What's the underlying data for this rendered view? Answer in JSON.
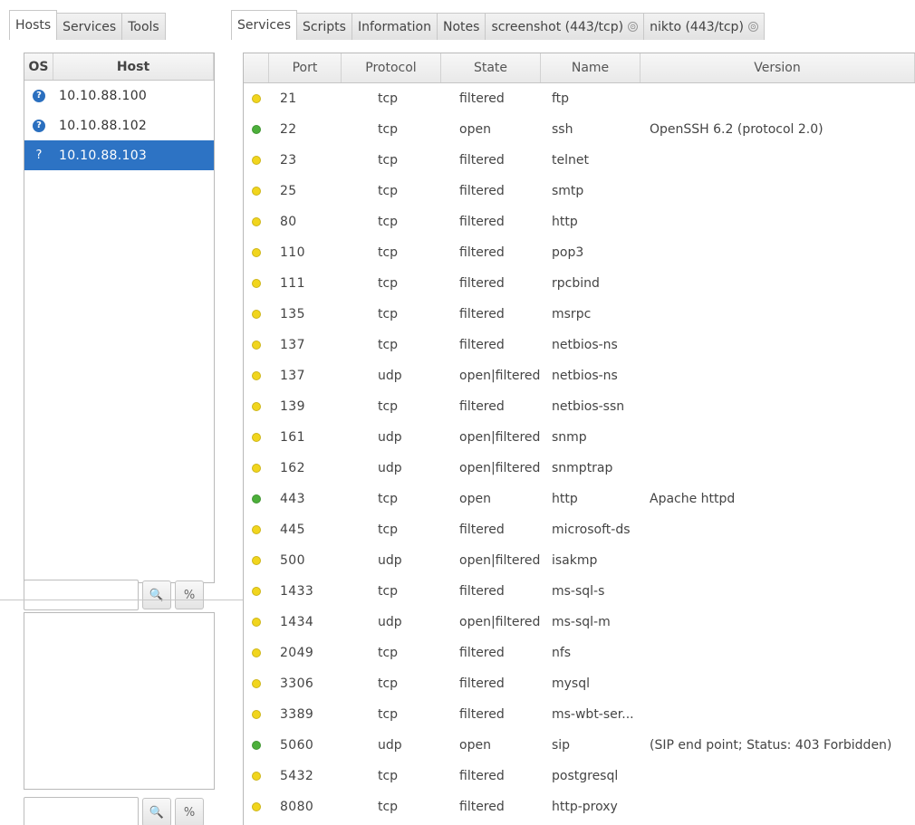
{
  "left_tabs": [
    "Hosts",
    "Services",
    "Tools"
  ],
  "right_tabs": [
    {
      "label": "Services"
    },
    {
      "label": "Scripts"
    },
    {
      "label": "Information"
    },
    {
      "label": "Notes"
    },
    {
      "label": "screenshot (443/tcp)"
    },
    {
      "label": "nikto (443/tcp)"
    }
  ],
  "tab_close_glyph": "⊙",
  "hosts_header": {
    "os": "OS",
    "host": "Host"
  },
  "hosts": [
    {
      "os_icon": "question-icon",
      "os": "?",
      "ip": "10.10.88.100"
    },
    {
      "os_icon": "question-icon",
      "os": "?",
      "ip": "10.10.88.102"
    },
    {
      "os_icon": "question-plain-icon",
      "os": "?",
      "ip": "10.10.88.103"
    }
  ],
  "filter": {
    "search_glyph": "🔍",
    "toggle_glyph": "%"
  },
  "services_header": {
    "port": "Port",
    "protocol": "Protocol",
    "state": "State",
    "name": "Name",
    "version": "Version"
  },
  "colors": {
    "open": "#4caf3a",
    "filtered": "#f1d51d",
    "selection": "#2d73c4"
  },
  "services": [
    {
      "port": "21",
      "protocol": "tcp",
      "state": "filtered",
      "name": "ftp",
      "version": ""
    },
    {
      "port": "22",
      "protocol": "tcp",
      "state": "open",
      "name": "ssh",
      "version": "OpenSSH 6.2 (protocol 2.0)"
    },
    {
      "port": "23",
      "protocol": "tcp",
      "state": "filtered",
      "name": "telnet",
      "version": ""
    },
    {
      "port": "25",
      "protocol": "tcp",
      "state": "filtered",
      "name": "smtp",
      "version": ""
    },
    {
      "port": "80",
      "protocol": "tcp",
      "state": "filtered",
      "name": "http",
      "version": ""
    },
    {
      "port": "110",
      "protocol": "tcp",
      "state": "filtered",
      "name": "pop3",
      "version": ""
    },
    {
      "port": "111",
      "protocol": "tcp",
      "state": "filtered",
      "name": "rpcbind",
      "version": ""
    },
    {
      "port": "135",
      "protocol": "tcp",
      "state": "filtered",
      "name": "msrpc",
      "version": ""
    },
    {
      "port": "137",
      "protocol": "tcp",
      "state": "filtered",
      "name": "netbios-ns",
      "version": ""
    },
    {
      "port": "137",
      "protocol": "udp",
      "state": "open|filtered",
      "name": "netbios-ns",
      "version": ""
    },
    {
      "port": "139",
      "protocol": "tcp",
      "state": "filtered",
      "name": "netbios-ssn",
      "version": ""
    },
    {
      "port": "161",
      "protocol": "udp",
      "state": "open|filtered",
      "name": "snmp",
      "version": ""
    },
    {
      "port": "162",
      "protocol": "udp",
      "state": "open|filtered",
      "name": "snmptrap",
      "version": ""
    },
    {
      "port": "443",
      "protocol": "tcp",
      "state": "open",
      "name": "http",
      "version": "Apache httpd"
    },
    {
      "port": "445",
      "protocol": "tcp",
      "state": "filtered",
      "name": "microsoft-ds",
      "version": ""
    },
    {
      "port": "500",
      "protocol": "udp",
      "state": "open|filtered",
      "name": "isakmp",
      "version": ""
    },
    {
      "port": "1433",
      "protocol": "tcp",
      "state": "filtered",
      "name": "ms-sql-s",
      "version": ""
    },
    {
      "port": "1434",
      "protocol": "udp",
      "state": "open|filtered",
      "name": "ms-sql-m",
      "version": ""
    },
    {
      "port": "2049",
      "protocol": "tcp",
      "state": "filtered",
      "name": "nfs",
      "version": ""
    },
    {
      "port": "3306",
      "protocol": "tcp",
      "state": "filtered",
      "name": "mysql",
      "version": ""
    },
    {
      "port": "3389",
      "protocol": "tcp",
      "state": "filtered",
      "name": "ms-wbt-ser...",
      "version": ""
    },
    {
      "port": "5060",
      "protocol": "udp",
      "state": "open",
      "name": "sip",
      "version": "(SIP end point; Status: 403 Forbidden)"
    },
    {
      "port": "5432",
      "protocol": "tcp",
      "state": "filtered",
      "name": "postgresql",
      "version": ""
    },
    {
      "port": "8080",
      "protocol": "tcp",
      "state": "filtered",
      "name": "http-proxy",
      "version": ""
    }
  ]
}
